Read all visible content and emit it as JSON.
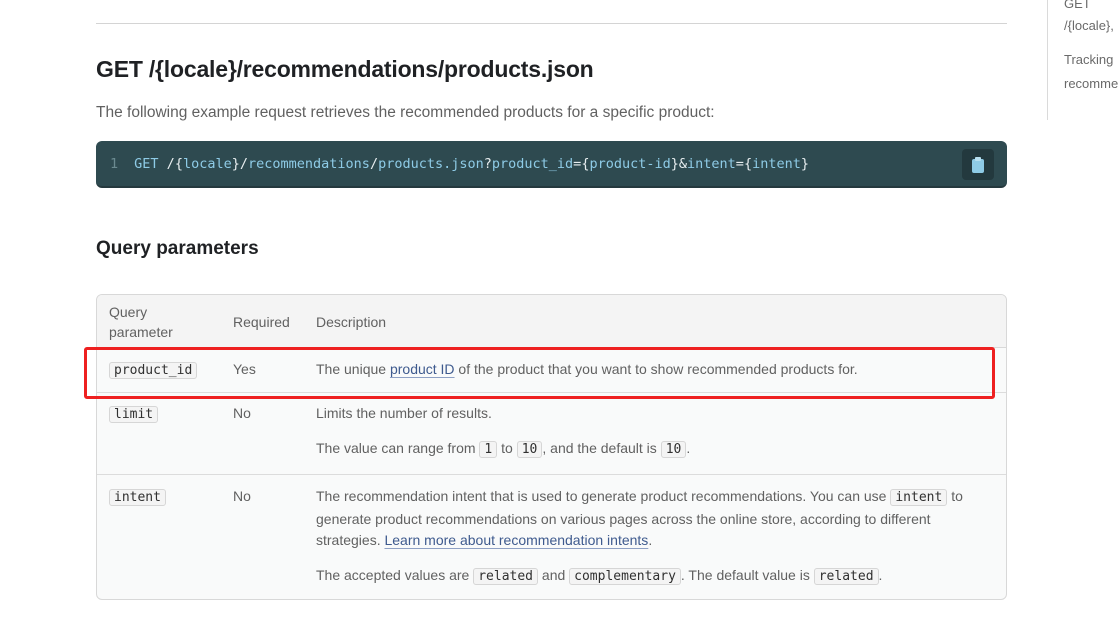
{
  "toc": {
    "items": [
      {
        "lines": [
          "GET",
          "/{locale}/recommendations/products.json"
        ]
      },
      {
        "lines": [
          "Tracking",
          "recommendations"
        ]
      }
    ],
    "visible_text": [
      "GET",
      "/{locale},",
      "Tracking",
      "recomme"
    ]
  },
  "section": {
    "title": "GET /{locale}/recommendations/products.json",
    "intro": "The following example request retrieves the recommended products for a specific product:"
  },
  "code_example": {
    "line_number": "1",
    "method": "GET",
    "tokens": [
      "/",
      "{",
      "locale",
      "}",
      "/",
      "recommendations",
      "/",
      "products.json",
      "?",
      "product_id",
      "=",
      "{",
      "product-id",
      "}",
      "&",
      "intent",
      "=",
      "{",
      "intent",
      "}"
    ],
    "copy_icon": "clipboard-icon"
  },
  "query_parameters": {
    "heading": "Query parameters",
    "columns": [
      "Query parameter",
      "Required",
      "Description"
    ],
    "column_lines": {
      "param_1": "Query",
      "param_2": "parameter"
    },
    "rows": [
      {
        "param": "product_id",
        "required": "Yes",
        "desc_pre": "The unique ",
        "desc_link": "product ID",
        "desc_post": " of the product that you want to show recommended products for.",
        "highlighted": true
      },
      {
        "param": "limit",
        "required": "No",
        "desc": "Limits the number of results.",
        "desc2_pre": "The value can range from ",
        "min": "1",
        "desc2_mid": " to ",
        "max": "10",
        "desc2_mid2": ", and the default is ",
        "default": "10",
        "desc2_post": "."
      },
      {
        "param": "intent",
        "required": "No",
        "desc_pre": "The recommendation intent that is used to generate product recommendations. You can use ",
        "desc_code": "intent",
        "desc_mid": " to generate product recommendations on various pages across the online store, according to different strategies. ",
        "desc_link": "Learn more about recommendation intents",
        "desc_post": ".",
        "desc2_pre": "The accepted values are ",
        "value1": "related",
        "desc2_and": " and ",
        "value2": "complementary",
        "desc2_mid": ". The default value is ",
        "default": "related",
        "desc2_post": "."
      }
    ]
  },
  "colors": {
    "code_bg": "#2e4a50",
    "code_text": "#8ecbe6",
    "link": "#3e5a8e",
    "highlight": "#ee2020"
  }
}
